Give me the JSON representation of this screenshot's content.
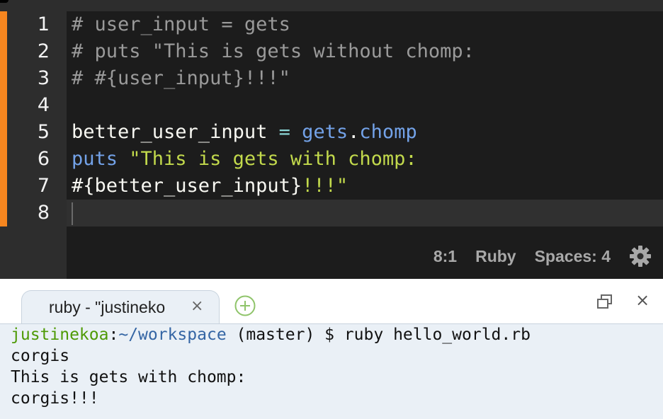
{
  "editor": {
    "line_numbers": [
      "1",
      "2",
      "3",
      "4",
      "5",
      "6",
      "7",
      "8"
    ],
    "lines": [
      [
        {
          "t": "# user_input = gets",
          "c": "cm"
        }
      ],
      [
        {
          "t": "# puts \"This is gets without chomp:",
          "c": "cm"
        }
      ],
      [
        {
          "t": "# #{user_input}!!!\"",
          "c": "cm"
        }
      ],
      [],
      [
        {
          "t": "better_user_input",
          "c": "var"
        },
        {
          "t": " = ",
          "c": "op"
        },
        {
          "t": "gets",
          "c": "fn"
        },
        {
          "t": ".",
          "c": "var"
        },
        {
          "t": "chomp",
          "c": "fn"
        }
      ],
      [
        {
          "t": "puts",
          "c": "fn"
        },
        {
          "t": " \"This is gets with chomp:",
          "c": "str"
        }
      ],
      [
        {
          "t": "#{better_user_input}",
          "c": "var"
        },
        {
          "t": "!!!\"",
          "c": "str"
        }
      ],
      []
    ],
    "active_line_index": 7
  },
  "statusbar": {
    "position": "8:1",
    "language": "Ruby",
    "indentation": "Spaces: 4",
    "settings_icon": "gear-icon"
  },
  "terminal": {
    "tab_label": "ruby - \"justineko",
    "tab_close": "×",
    "add_tab_icon": "plus-circle-icon",
    "restore_icon": "restore-window-icon",
    "close_panel": "×",
    "prompt_user": "justinekoa",
    "prompt_sep": ":",
    "prompt_path": "~/workspace",
    "prompt_rest": " (master) $ ruby hello_world.rb",
    "output": [
      "corgis",
      "This is gets with chomp:",
      "corgis!!!"
    ]
  },
  "colors": {
    "accent_orange": "#f6861f",
    "comment": "#9a9a9a",
    "function": "#73a2e8",
    "string": "#c2d94c",
    "prompt_user": "#4e9a06",
    "prompt_path": "#3465a4"
  }
}
